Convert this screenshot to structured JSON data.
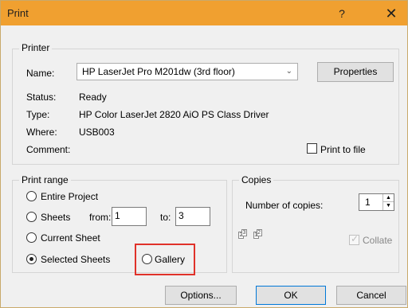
{
  "window": {
    "title": "Print",
    "help": "?",
    "close": "✕"
  },
  "printer": {
    "legend": "Printer",
    "name_label": "Name:",
    "name_value": "HP LaserJet Pro M201dw (3rd floor)",
    "properties_label": "Properties",
    "status_label": "Status:",
    "status_value": "Ready",
    "type_label": "Type:",
    "type_value": "HP Color LaserJet 2820 AiO PS Class Driver",
    "where_label": "Where:",
    "where_value": "USB003",
    "comment_label": "Comment:",
    "print_to_file_label": "Print to file",
    "print_to_file_checked": false
  },
  "print_range": {
    "legend": "Print range",
    "options": [
      {
        "label": "Entire Project",
        "selected": false
      },
      {
        "label": "Sheets",
        "selected": false
      },
      {
        "label": "Current Sheet",
        "selected": false
      },
      {
        "label": "Selected Sheets",
        "selected": true
      },
      {
        "label": "Gallery",
        "selected": false
      }
    ],
    "from_label": "from:",
    "from_value": "1",
    "to_label": "to:",
    "to_value": "3"
  },
  "copies": {
    "legend": "Copies",
    "number_label": "Number of copies:",
    "number_value": "1",
    "collate_label": "Collate",
    "collate_checked": true,
    "collate_disabled": true
  },
  "buttons": {
    "options": "Options...",
    "ok": "OK",
    "cancel": "Cancel"
  },
  "colors": {
    "titlebar": "#f0a030",
    "highlight": "#e0322a"
  }
}
